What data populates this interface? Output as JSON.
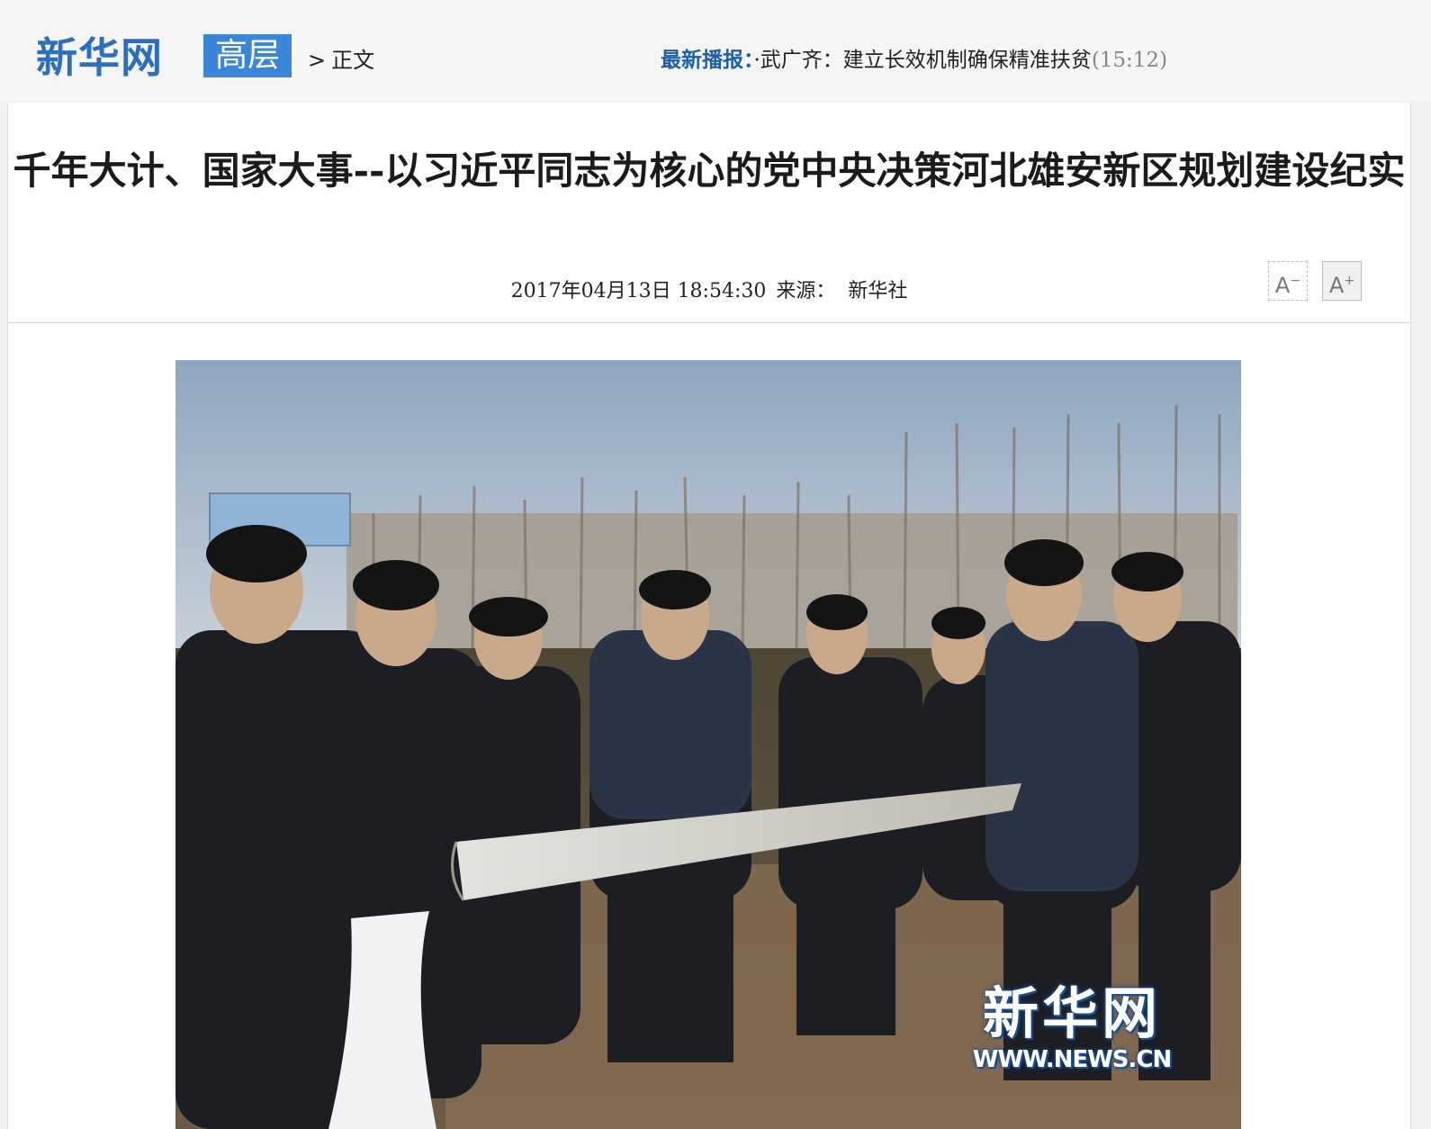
{
  "header": {
    "logo": "新华网",
    "section": "高层",
    "breadcrumb_sep": ">",
    "breadcrumb_current": "正文",
    "ticker_label": "最新播报：",
    "ticker_headline": "·武广齐：建立长效机制确保精准扶贫",
    "ticker_time": "(15:12)"
  },
  "article": {
    "title": "千年大计、国家大事--以习近平同志为核心的党中央决策河北雄安新区规划建设纪实",
    "datetime": "2017年04月13日 18:54:30",
    "source_label": "来源：",
    "source": "新华社",
    "font_decrease": "A",
    "font_decrease_sign": "−",
    "font_increase": "A",
    "font_increase_sign": "+"
  },
  "photo": {
    "watermark_cn": "新华网",
    "watermark_en": "WWW.NEWS.CN"
  }
}
